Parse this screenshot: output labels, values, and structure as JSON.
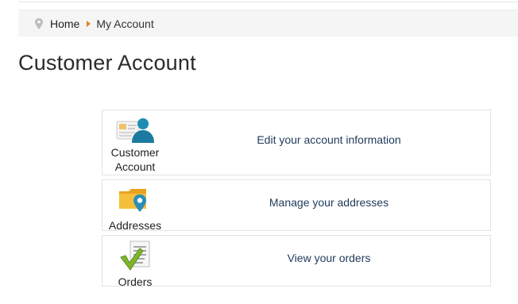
{
  "breadcrumb": {
    "home_label": "Home",
    "current_label": "My Account"
  },
  "page": {
    "title": "Customer Account"
  },
  "panels": [
    {
      "icon": "customer-account-icon",
      "label": "Customer\nAccount",
      "action": "Edit your account information"
    },
    {
      "icon": "addresses-icon",
      "label": "Addresses",
      "action": "Manage your addresses"
    },
    {
      "icon": "orders-icon",
      "label": "Orders",
      "action": "View your orders"
    }
  ],
  "colors": {
    "breadcrumb_bg": "#f5f5f5",
    "breadcrumb_separator": "#e8801b",
    "link": "#1f3a5a"
  }
}
